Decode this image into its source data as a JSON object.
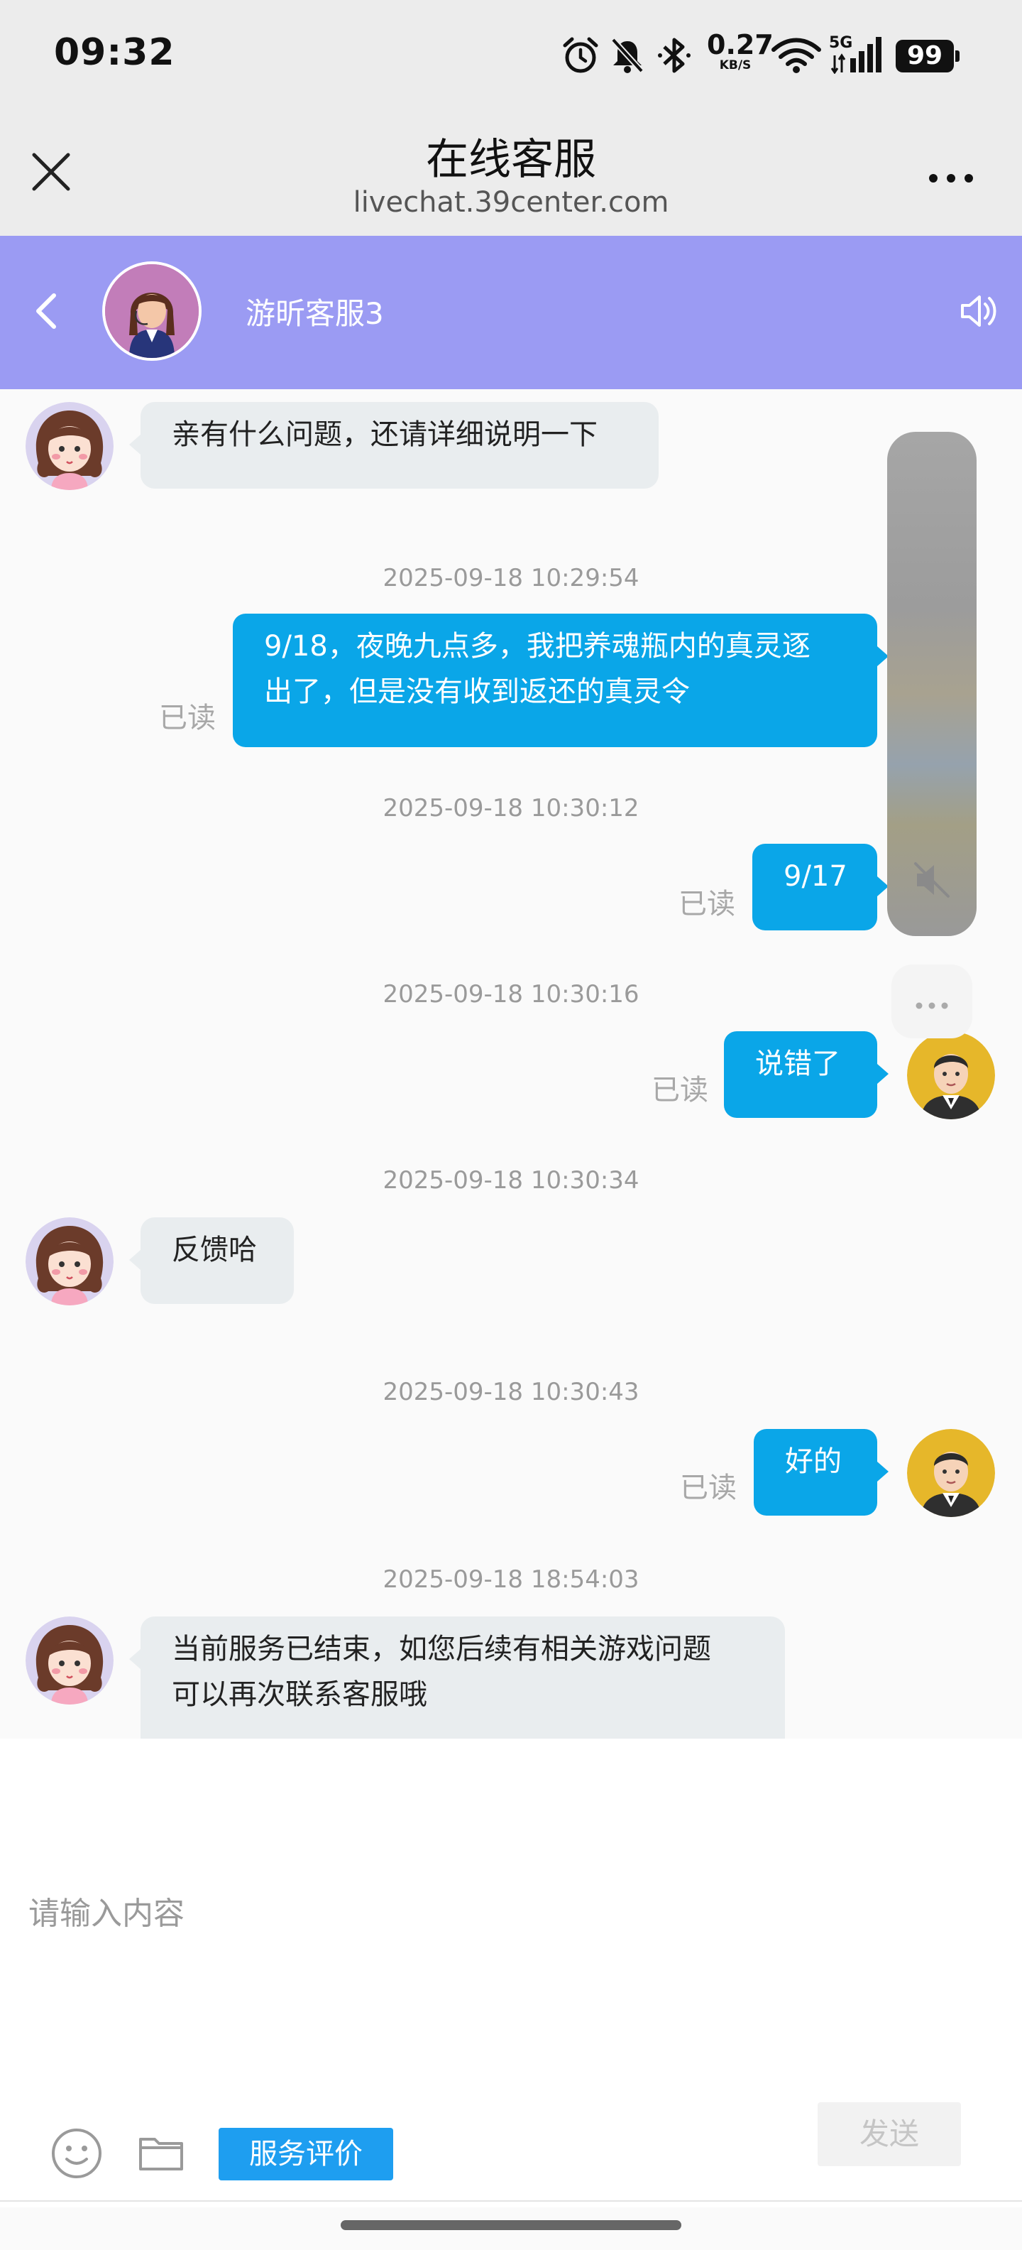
{
  "status_bar": {
    "time": "09:32",
    "net_speed": "0.27",
    "net_unit": "KB/S",
    "network_type": "5G",
    "battery": "99"
  },
  "browser": {
    "title": "在线客服",
    "url": "livechat.39center.com"
  },
  "chat_header": {
    "agent_name": "游昕客服3",
    "header_color": "#9b9bf3"
  },
  "messages": [
    {
      "text": "亲有什么问题，还请详细说明一下"
    },
    {
      "time": "2025-09-18 10:29:54",
      "text_line1": "9/18，夜晚九点多，我把养魂瓶内的真灵逐",
      "text_line2": "出了，但是没有收到返还的真灵令",
      "status": "已读"
    },
    {
      "time": "2025-09-18 10:30:12",
      "text": "9/17",
      "status": "已读"
    },
    {
      "time": "2025-09-18 10:30:16",
      "text": "说错了",
      "status": "已读"
    },
    {
      "time": "2025-09-18 10:30:34",
      "text": "反馈哈"
    },
    {
      "time": "2025-09-18 10:30:43",
      "text": "好的",
      "status": "已读"
    },
    {
      "time": "2025-09-18 18:54:03",
      "text_line1": "当前服务已结束，如您后续有相关游戏问题",
      "text_line2": "可以再次联系客服哦"
    }
  ],
  "composer": {
    "placeholder": "请输入内容",
    "rate_label": "服务评价",
    "send_label": "发送"
  },
  "colors": {
    "outgoing_bubble": "#0aa6e8",
    "incoming_bubble": "#e9edef",
    "rate_button": "#1e9ef0"
  }
}
